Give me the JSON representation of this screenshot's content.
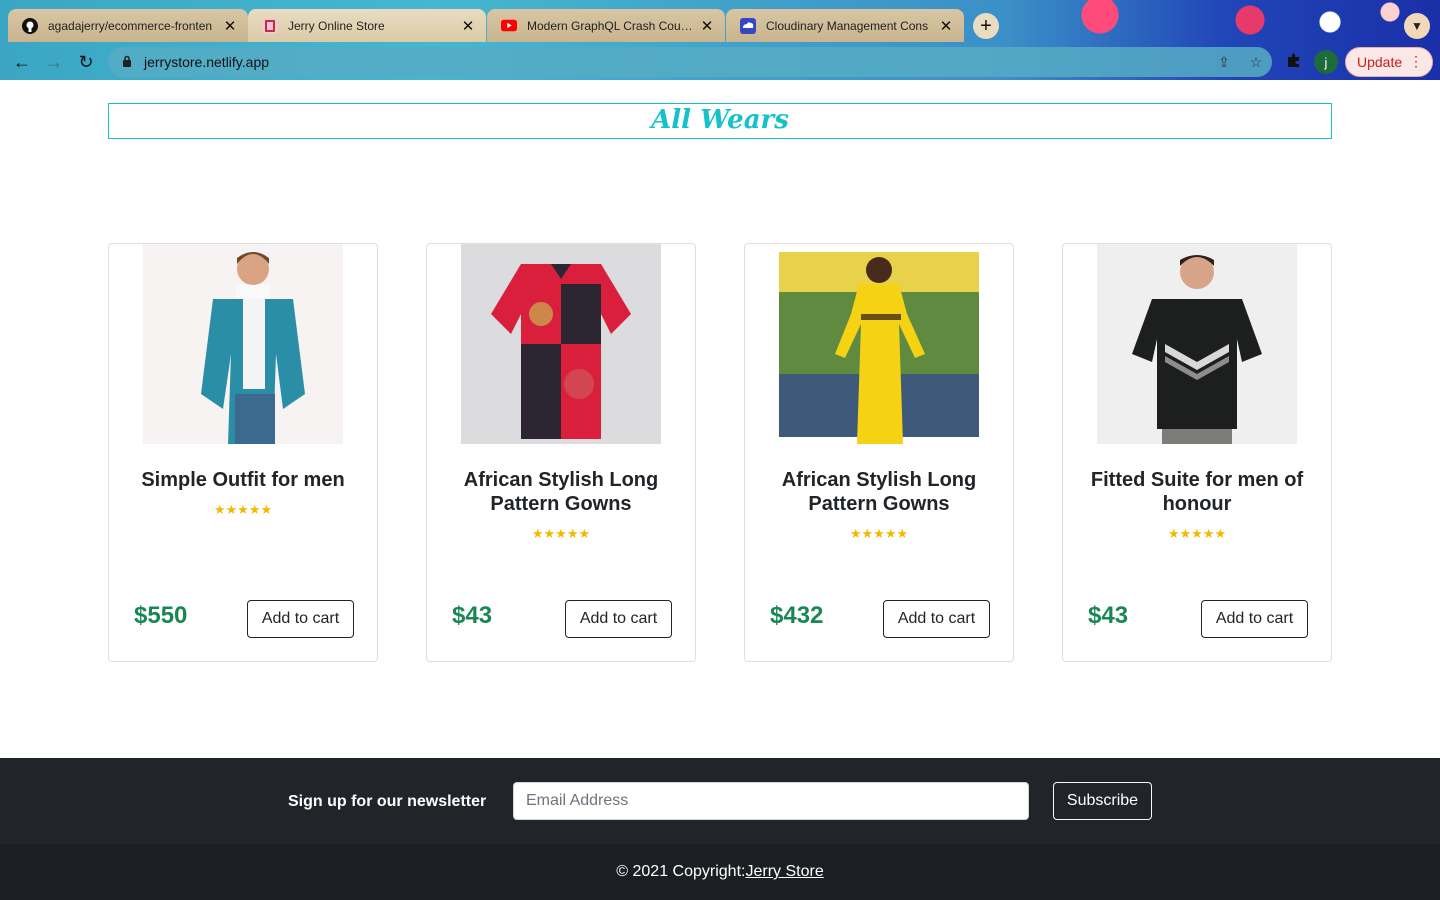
{
  "browser": {
    "tabs": [
      {
        "title": "agadajerry/ecommerce-fronten",
        "favicon": "github-icon",
        "active": false
      },
      {
        "title": "Jerry Online Store",
        "favicon": "store-favicon",
        "active": true
      },
      {
        "title": "Modern GraphQL Crash Course",
        "favicon": "youtube-icon",
        "active": false
      },
      {
        "title": "Cloudinary Management Cons",
        "favicon": "cloudinary-icon",
        "active": false
      }
    ],
    "url": "jerrystore.netlify.app",
    "profile_initial": "j",
    "update_label": "Update"
  },
  "page": {
    "heading": "All Wears"
  },
  "products": [
    {
      "name": "Simple Outfit for men",
      "rating_stars": 5,
      "price": "$550",
      "cart_label": "Add to cart"
    },
    {
      "name": "African Stylish Long Pattern Gowns",
      "rating_stars": 5,
      "price": "$43",
      "cart_label": "Add to cart"
    },
    {
      "name": "African Stylish Long Pattern Gowns",
      "rating_stars": 5,
      "price": "$432",
      "cart_label": "Add to cart"
    },
    {
      "name": "Fitted Suite for men of honour",
      "rating_stars": 5,
      "price": "$43",
      "cart_label": "Add to cart"
    }
  ],
  "footer": {
    "newsletter_label": "Sign up for our newsletter",
    "email_placeholder": "Email Address",
    "subscribe_label": "Subscribe",
    "copyright_prefix": "© 2021 Copyright:",
    "copyright_link": "Jerry Store"
  },
  "colors": {
    "accent": "#17c1c9",
    "price": "#198754",
    "star": "#f5b800",
    "footer_bg": "#212529"
  }
}
